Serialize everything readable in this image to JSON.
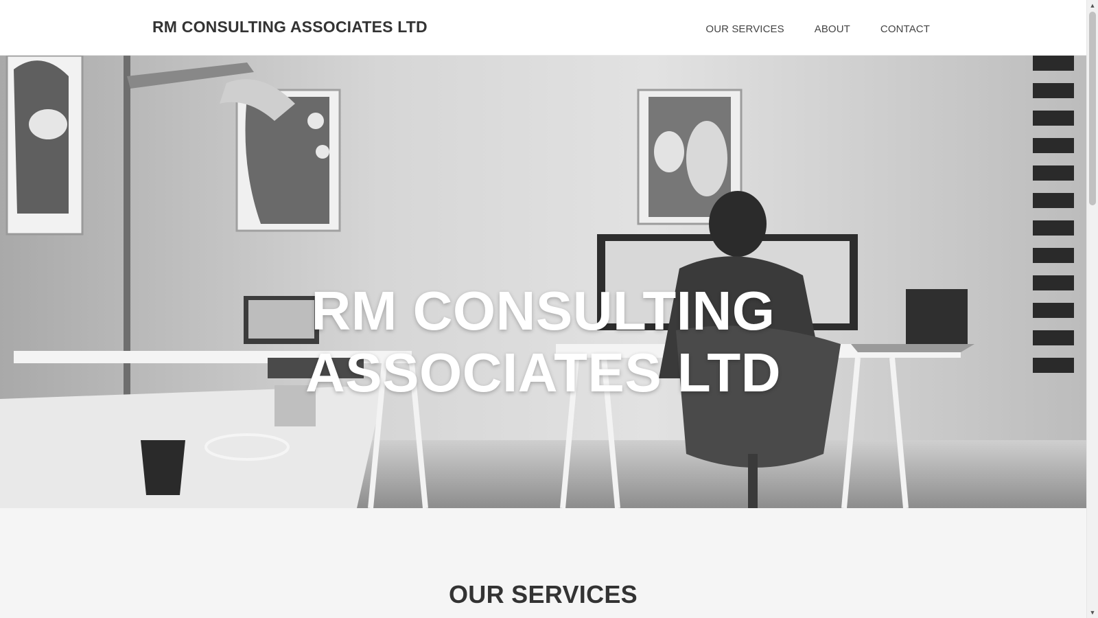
{
  "header": {
    "brand": "RM CONSULTING ASSOCIATES LTD",
    "nav": [
      {
        "label": "OUR SERVICES"
      },
      {
        "label": "ABOUT"
      },
      {
        "label": "CONTACT"
      }
    ]
  },
  "hero": {
    "title_line1": "RM CONSULTING",
    "title_line2": "ASSOCIATES LTD"
  },
  "services": {
    "heading": "OUR SERVICES"
  },
  "scrollbar": {
    "up_icon": "▲",
    "down_icon": "▼"
  },
  "colors": {
    "header_bg": "#ffffff",
    "text_dark": "#333333",
    "page_bg": "#f5f5f5",
    "hero_text": "#ffffff"
  }
}
